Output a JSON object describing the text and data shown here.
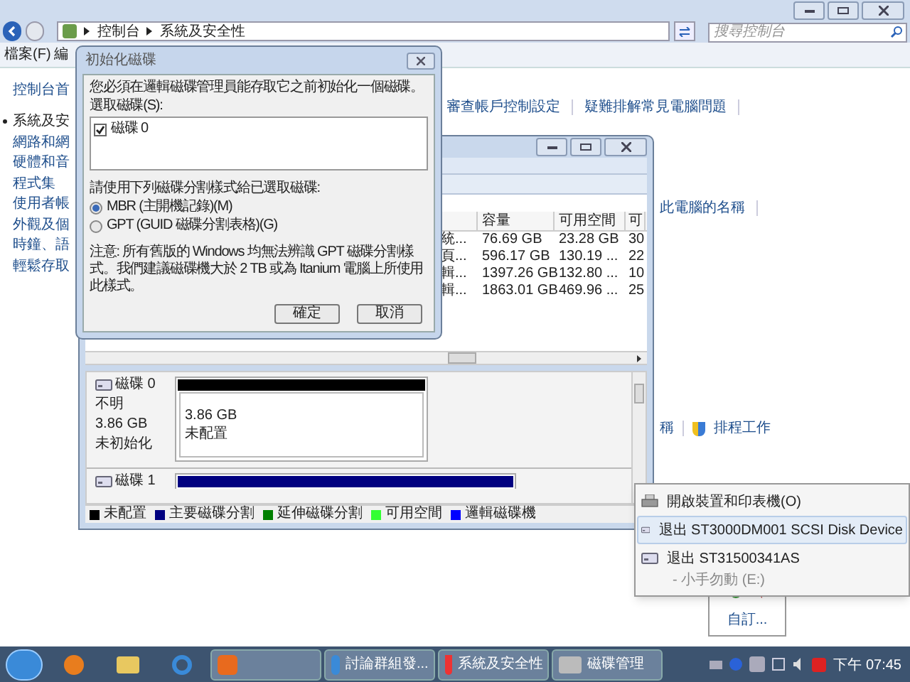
{
  "control_panel": {
    "breadcrumb": [
      "控制台",
      "系統及安全性"
    ],
    "search": {
      "placeholder": "搜尋控制台"
    },
    "menu": [
      "檔案(F)",
      "編"
    ],
    "sidebar": [
      {
        "label": "控制台首",
        "selected": false
      },
      {
        "label": "系統及安",
        "selected": true
      },
      {
        "label": "網路和網",
        "selected": false
      },
      {
        "label": "硬體和音",
        "selected": false
      },
      {
        "label": "程式集",
        "selected": false
      },
      {
        "label": "使用者帳",
        "selected": false
      },
      {
        "label": "外觀及個",
        "selected": false
      },
      {
        "label": "時鐘、語",
        "selected": false
      },
      {
        "label": "輕鬆存取",
        "selected": false
      }
    ],
    "links_row_1": [
      "審查帳戶控制設定",
      "疑難排解常見電腦問題"
    ],
    "links_row_2": [
      "此電腦的名稱"
    ],
    "links_row_3": [
      "稱",
      "排程工作"
    ]
  },
  "disk_management": {
    "table": {
      "columns": [
        "",
        "容量",
        "可用空間",
        "可"
      ],
      "rows": [
        [
          "統...",
          "76.69 GB",
          "23.28 GB",
          "30"
        ],
        [
          "頁...",
          "596.17 GB",
          "130.19 ...",
          "22"
        ],
        [
          "輯...",
          "1397.26 GB",
          "132.80 ...",
          "10"
        ],
        [
          "輯...",
          "1863.01 GB",
          "469.96 ...",
          "25"
        ]
      ]
    },
    "disks": [
      {
        "name": "磁碟 0",
        "lines": [
          "不明",
          "3.86 GB",
          "未初始化"
        ],
        "color": "#000000",
        "partition": [
          "3.86 GB",
          "未配置"
        ]
      },
      {
        "name": "磁碟 1",
        "color": "#000080"
      }
    ],
    "legend": [
      {
        "label": "未配置",
        "color": "#000000"
      },
      {
        "label": "主要磁碟分割",
        "color": "#000080"
      },
      {
        "label": "延伸磁碟分割",
        "color": "#008000"
      },
      {
        "label": "可用空間",
        "color": "#33ff33"
      },
      {
        "label": "邏輯磁碟機",
        "color": "#0000ff"
      }
    ]
  },
  "dialog": {
    "title": "初始化磁碟",
    "intro": "您必須在邏輯磁碟管理員能存取它之前初始化一個磁碟。",
    "list_label": "選取磁碟(S):",
    "disks": [
      {
        "label": "磁碟 0",
        "checked": true
      }
    ],
    "style_label": "請使用下列磁碟分割樣式給已選取磁碟:",
    "styles": [
      {
        "label": "MBR (主開機記錄)(M)",
        "selected": true
      },
      {
        "label": "GPT (GUID 磁碟分割表格)(G)",
        "selected": false
      }
    ],
    "note": "注意: 所有舊版的 Windows 均無法辨識 GPT 磁碟分割樣式。我們建議磁碟機大於 2 TB 或為 Itanium 電腦上所使用此樣式。",
    "buttons": [
      "確定",
      "取消"
    ]
  },
  "context_menu": [
    {
      "label": "開啟裝置和印表機(O)",
      "kind": "printer",
      "selected": false
    },
    {
      "label": "退出 ST3000DM001 SCSI Disk Device",
      "kind": "drive",
      "selected": true
    },
    {
      "label": "退出 ST31500341AS",
      "kind": "drive",
      "selected": false,
      "sub": "- 小手勿動 (E:)"
    }
  ],
  "tray_popup": {
    "customize": "自訂..."
  },
  "taskbar": {
    "buttons": [
      {
        "kind": "app"
      },
      {
        "label": "討論群組發...",
        "kind": "ie"
      },
      {
        "label": "系統及安全性",
        "kind": "shield"
      },
      {
        "label": "磁碟管理",
        "kind": "disk"
      }
    ],
    "clock": "下午 07:45"
  }
}
